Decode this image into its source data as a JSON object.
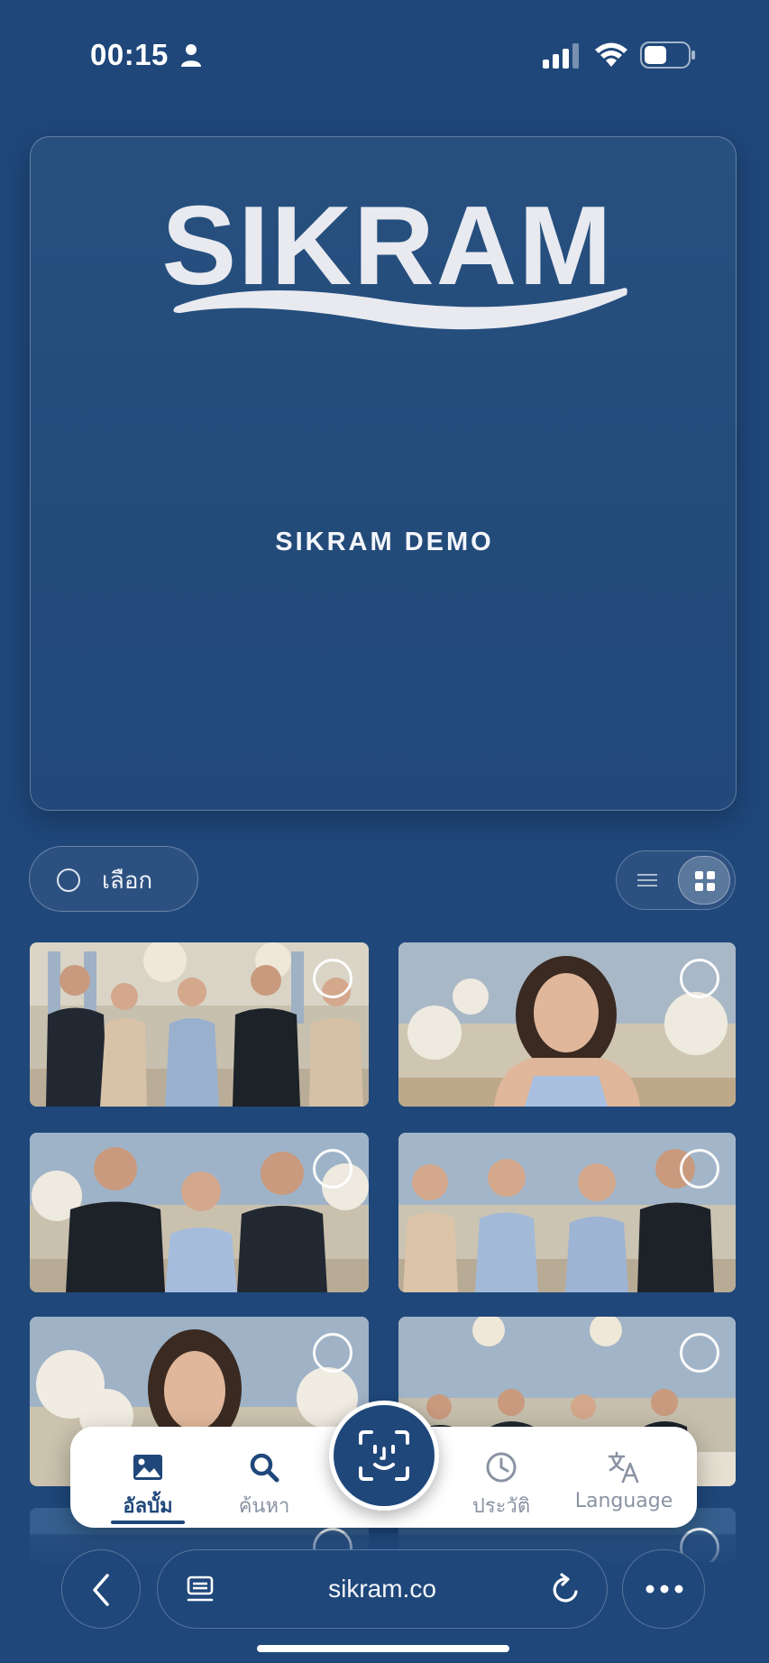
{
  "status_bar": {
    "time": "00:15",
    "icons": [
      "person-icon",
      "signal-icon",
      "wifi-icon",
      "battery-icon"
    ]
  },
  "hero": {
    "logo_text": "SIKRAM",
    "album_title": "SIKRAM DEMO"
  },
  "controls": {
    "select_label": "เลือก",
    "view_modes": [
      "list-view",
      "grid-view"
    ],
    "active_view": "grid-view"
  },
  "photos": [
    {
      "name": "group-photo-five-people"
    },
    {
      "name": "portrait-woman-blue-dress"
    },
    {
      "name": "three-people-toast"
    },
    {
      "name": "four-people-chatting"
    },
    {
      "name": "portrait-woman-flowers"
    },
    {
      "name": "banquet-table-guests"
    },
    {
      "name": "photo-row4-left"
    },
    {
      "name": "photo-row4-right"
    }
  ],
  "tab_bar": {
    "tabs": [
      {
        "label": "อัลบั้ม",
        "icon": "image-icon",
        "active": true
      },
      {
        "label": "ค้นหา",
        "icon": "search-icon",
        "active": false
      },
      {
        "label": "ประวัติ",
        "icon": "clock-icon",
        "active": false
      },
      {
        "label": "Language",
        "icon": "translate-icon",
        "active": false
      }
    ],
    "center_action_icon": "face-scan-icon"
  },
  "browser": {
    "url": "sikram.co"
  },
  "colors": {
    "background": "#1f477a",
    "accent": "#1f477a",
    "tab_inactive": "#8a93a3"
  }
}
